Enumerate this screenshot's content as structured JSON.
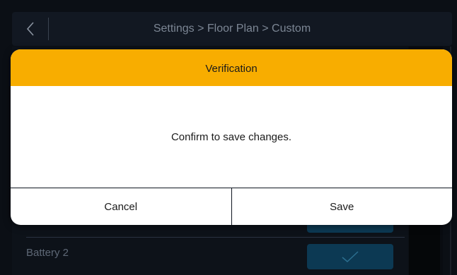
{
  "header": {
    "breadcrumb": "Settings > Floor Plan > Custom"
  },
  "background": {
    "row_label": "Battery 2",
    "row_checked": true
  },
  "dialog": {
    "title": "Verification",
    "message": "Confirm to save changes.",
    "cancel_label": "Cancel",
    "save_label": "Save"
  },
  "colors": {
    "dialog_header": "#f8ad00",
    "background": "#0b0f15",
    "toggle_button": "#0c3953"
  },
  "icons": {
    "back": "chevron-left-icon",
    "check": "checkmark-icon"
  }
}
